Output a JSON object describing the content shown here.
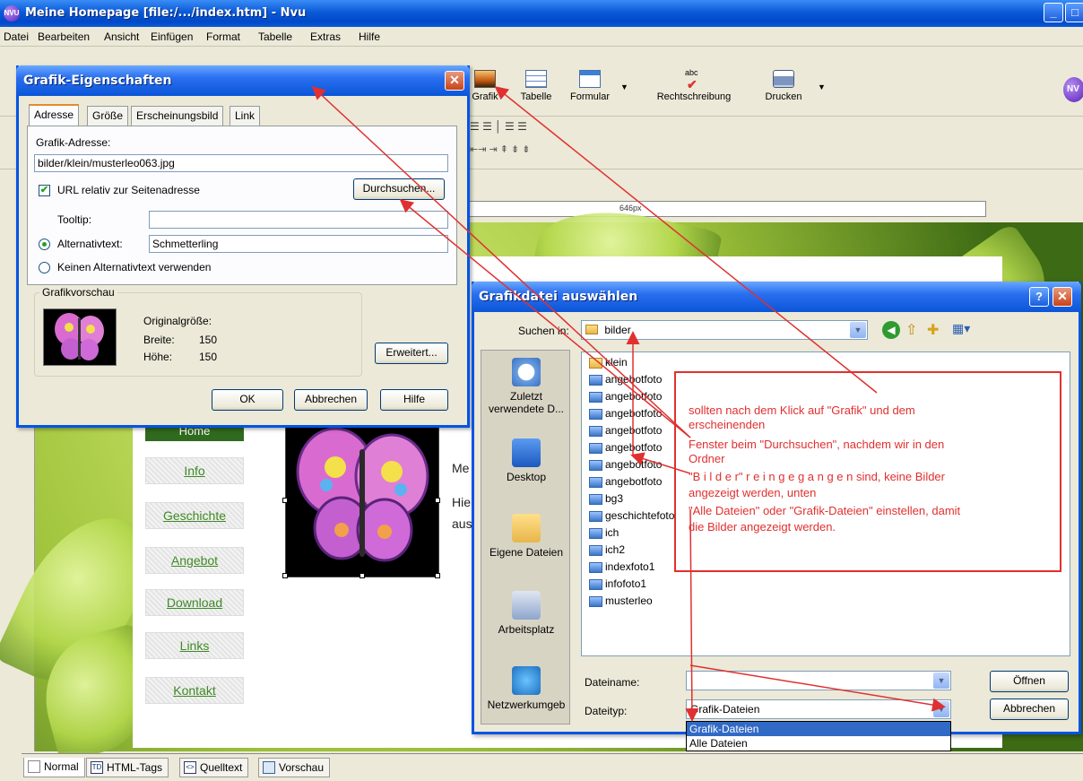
{
  "window": {
    "title": "Meine Homepage [file:/.../index.htm] - Nvu",
    "logo_text": "NVU"
  },
  "menubar": [
    "Datei",
    "Bearbeiten",
    "Ansicht",
    "Einfügen",
    "Format",
    "Tabelle",
    "Extras",
    "Hilfe"
  ],
  "toolbar": {
    "items": [
      {
        "label": "Grafik",
        "icon": "image-icon"
      },
      {
        "label": "Tabelle",
        "icon": "table-icon"
      },
      {
        "label": "Formular",
        "icon": "form-icon"
      },
      {
        "label": "Rechtschreibung",
        "icon": "spellcheck-icon"
      },
      {
        "label": "Drucken",
        "icon": "printer-icon"
      }
    ],
    "spellcheck_badge": "abc"
  },
  "ruler_label": "646px",
  "page": {
    "nav": [
      "Home",
      "Info",
      "Geschichte",
      "Angebot",
      "Download",
      "Links",
      "Kontakt"
    ],
    "text_fragments": [
      "Me",
      "Hie",
      "aus"
    ]
  },
  "bottom_tabs": [
    {
      "label": "Normal",
      "icon_text": ""
    },
    {
      "label": "HTML-Tags",
      "icon_text": "TD"
    },
    {
      "label": "Quelltext",
      "icon_text": "<>"
    },
    {
      "label": "Vorschau",
      "icon_text": ""
    }
  ],
  "image_dialog": {
    "title": "Grafik-Eigenschaften",
    "tabs": [
      "Adresse",
      "Größe",
      "Erscheinungsbild",
      "Link"
    ],
    "address_label": "Grafik-Adresse:",
    "address_value": "bilder/klein/musterleo063.jpg",
    "relative_url_label": "URL relativ zur Seitenadresse",
    "relative_url_checked": true,
    "browse_button": "Durchsuchen...",
    "tooltip_label": "Tooltip:",
    "tooltip_value": "",
    "alt_text_label": "Alternativtext:",
    "alt_text_value": "Schmetterling",
    "no_alt_label": "Keinen Alternativtext verwenden",
    "preview_group": "Grafikvorschau",
    "original_size_label": "Originalgröße:",
    "width_label": "Breite:",
    "width_value": "150",
    "height_label": "Höhe:",
    "height_value": "150",
    "advanced_button": "Erweitert...",
    "ok_button": "OK",
    "cancel_button": "Abbrechen",
    "help_button": "Hilfe"
  },
  "file_dialog": {
    "title": "Grafikdatei auswählen",
    "help_button": "?",
    "look_in_label": "Suchen in:",
    "look_in_value": "bilder",
    "places": [
      "Zuletzt verwendete D...",
      "Desktop",
      "Eigene Dateien",
      "Arbeitsplatz",
      "Netzwerkumgeb"
    ],
    "files": [
      {
        "name": "klein",
        "type": "folder"
      },
      {
        "name": "angebotfoto",
        "type": "image"
      },
      {
        "name": "angebotfoto",
        "type": "image"
      },
      {
        "name": "angebotfoto",
        "type": "image"
      },
      {
        "name": "angebotfoto",
        "type": "image"
      },
      {
        "name": "angebotfoto",
        "type": "image"
      },
      {
        "name": "angebotfoto",
        "type": "image"
      },
      {
        "name": "angebotfoto",
        "type": "image"
      },
      {
        "name": "bg3",
        "type": "image"
      },
      {
        "name": "geschichtefoto",
        "type": "image"
      },
      {
        "name": "ich",
        "type": "image"
      },
      {
        "name": "ich2",
        "type": "image"
      },
      {
        "name": "indexfoto1",
        "type": "image"
      },
      {
        "name": "infofoto1",
        "type": "image"
      },
      {
        "name": "musterleo",
        "type": "image"
      }
    ],
    "filename_label": "Dateiname:",
    "filename_value": "",
    "filetype_label": "Dateityp:",
    "filetype_value": "Grafik-Dateien",
    "filetype_options": [
      "Grafik-Dateien",
      "Alle Dateien"
    ],
    "open_button": "Öffnen",
    "cancel_button": "Abbrechen"
  },
  "annotation": {
    "lines": [
      "sollten nach dem Klick auf \"Grafik\" und dem",
      "erscheinenden",
      "Fenster beim \"Durchsuchen\", nachdem wir in den",
      "Ordner",
      "\"B i l d e r\"   r e i n g e g a n g e n sind, keine Bilder",
      "angezeigt werden, unten",
      "\"Alle Dateien\" oder \"Grafik-Dateien\" einstellen, damit",
      "die Bilder angezeigt werden."
    ],
    "color": "#e0302f"
  }
}
